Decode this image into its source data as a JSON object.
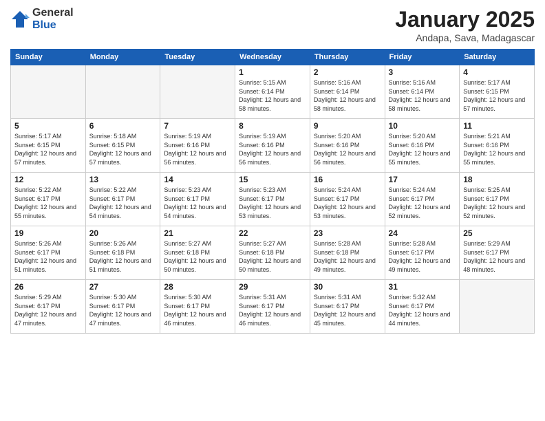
{
  "logo": {
    "general": "General",
    "blue": "Blue"
  },
  "header": {
    "month": "January 2025",
    "location": "Andapa, Sava, Madagascar"
  },
  "days_of_week": [
    "Sunday",
    "Monday",
    "Tuesday",
    "Wednesday",
    "Thursday",
    "Friday",
    "Saturday"
  ],
  "weeks": [
    [
      {
        "day": "",
        "info": ""
      },
      {
        "day": "",
        "info": ""
      },
      {
        "day": "",
        "info": ""
      },
      {
        "day": "1",
        "info": "Sunrise: 5:15 AM\nSunset: 6:14 PM\nDaylight: 12 hours\nand 58 minutes."
      },
      {
        "day": "2",
        "info": "Sunrise: 5:16 AM\nSunset: 6:14 PM\nDaylight: 12 hours\nand 58 minutes."
      },
      {
        "day": "3",
        "info": "Sunrise: 5:16 AM\nSunset: 6:14 PM\nDaylight: 12 hours\nand 58 minutes."
      },
      {
        "day": "4",
        "info": "Sunrise: 5:17 AM\nSunset: 6:15 PM\nDaylight: 12 hours\nand 57 minutes."
      }
    ],
    [
      {
        "day": "5",
        "info": "Sunrise: 5:17 AM\nSunset: 6:15 PM\nDaylight: 12 hours\nand 57 minutes."
      },
      {
        "day": "6",
        "info": "Sunrise: 5:18 AM\nSunset: 6:15 PM\nDaylight: 12 hours\nand 57 minutes."
      },
      {
        "day": "7",
        "info": "Sunrise: 5:19 AM\nSunset: 6:16 PM\nDaylight: 12 hours\nand 56 minutes."
      },
      {
        "day": "8",
        "info": "Sunrise: 5:19 AM\nSunset: 6:16 PM\nDaylight: 12 hours\nand 56 minutes."
      },
      {
        "day": "9",
        "info": "Sunrise: 5:20 AM\nSunset: 6:16 PM\nDaylight: 12 hours\nand 56 minutes."
      },
      {
        "day": "10",
        "info": "Sunrise: 5:20 AM\nSunset: 6:16 PM\nDaylight: 12 hours\nand 55 minutes."
      },
      {
        "day": "11",
        "info": "Sunrise: 5:21 AM\nSunset: 6:16 PM\nDaylight: 12 hours\nand 55 minutes."
      }
    ],
    [
      {
        "day": "12",
        "info": "Sunrise: 5:22 AM\nSunset: 6:17 PM\nDaylight: 12 hours\nand 55 minutes."
      },
      {
        "day": "13",
        "info": "Sunrise: 5:22 AM\nSunset: 6:17 PM\nDaylight: 12 hours\nand 54 minutes."
      },
      {
        "day": "14",
        "info": "Sunrise: 5:23 AM\nSunset: 6:17 PM\nDaylight: 12 hours\nand 54 minutes."
      },
      {
        "day": "15",
        "info": "Sunrise: 5:23 AM\nSunset: 6:17 PM\nDaylight: 12 hours\nand 53 minutes."
      },
      {
        "day": "16",
        "info": "Sunrise: 5:24 AM\nSunset: 6:17 PM\nDaylight: 12 hours\nand 53 minutes."
      },
      {
        "day": "17",
        "info": "Sunrise: 5:24 AM\nSunset: 6:17 PM\nDaylight: 12 hours\nand 52 minutes."
      },
      {
        "day": "18",
        "info": "Sunrise: 5:25 AM\nSunset: 6:17 PM\nDaylight: 12 hours\nand 52 minutes."
      }
    ],
    [
      {
        "day": "19",
        "info": "Sunrise: 5:26 AM\nSunset: 6:17 PM\nDaylight: 12 hours\nand 51 minutes."
      },
      {
        "day": "20",
        "info": "Sunrise: 5:26 AM\nSunset: 6:18 PM\nDaylight: 12 hours\nand 51 minutes."
      },
      {
        "day": "21",
        "info": "Sunrise: 5:27 AM\nSunset: 6:18 PM\nDaylight: 12 hours\nand 50 minutes."
      },
      {
        "day": "22",
        "info": "Sunrise: 5:27 AM\nSunset: 6:18 PM\nDaylight: 12 hours\nand 50 minutes."
      },
      {
        "day": "23",
        "info": "Sunrise: 5:28 AM\nSunset: 6:18 PM\nDaylight: 12 hours\nand 49 minutes."
      },
      {
        "day": "24",
        "info": "Sunrise: 5:28 AM\nSunset: 6:17 PM\nDaylight: 12 hours\nand 49 minutes."
      },
      {
        "day": "25",
        "info": "Sunrise: 5:29 AM\nSunset: 6:17 PM\nDaylight: 12 hours\nand 48 minutes."
      }
    ],
    [
      {
        "day": "26",
        "info": "Sunrise: 5:29 AM\nSunset: 6:17 PM\nDaylight: 12 hours\nand 47 minutes."
      },
      {
        "day": "27",
        "info": "Sunrise: 5:30 AM\nSunset: 6:17 PM\nDaylight: 12 hours\nand 47 minutes."
      },
      {
        "day": "28",
        "info": "Sunrise: 5:30 AM\nSunset: 6:17 PM\nDaylight: 12 hours\nand 46 minutes."
      },
      {
        "day": "29",
        "info": "Sunrise: 5:31 AM\nSunset: 6:17 PM\nDaylight: 12 hours\nand 46 minutes."
      },
      {
        "day": "30",
        "info": "Sunrise: 5:31 AM\nSunset: 6:17 PM\nDaylight: 12 hours\nand 45 minutes."
      },
      {
        "day": "31",
        "info": "Sunrise: 5:32 AM\nSunset: 6:17 PM\nDaylight: 12 hours\nand 44 minutes."
      },
      {
        "day": "",
        "info": ""
      }
    ]
  ]
}
